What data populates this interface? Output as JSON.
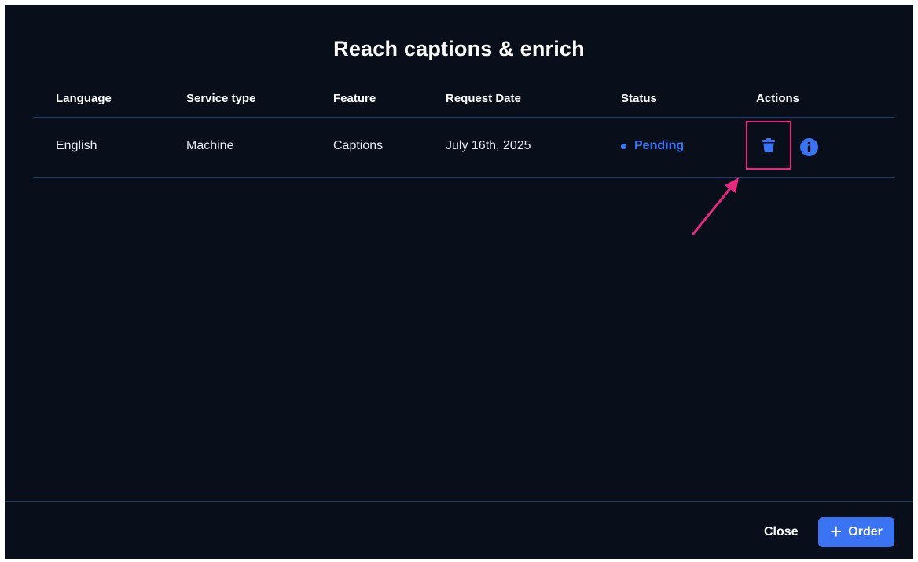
{
  "modal": {
    "title": "Reach captions & enrich"
  },
  "table": {
    "headers": [
      "Language",
      "Service type",
      "Feature",
      "Request Date",
      "Status",
      "Actions"
    ],
    "rows": [
      {
        "language": "English",
        "service_type": "Machine",
        "feature": "Captions",
        "request_date": "July 16th, 2025",
        "status": "Pending",
        "actions": [
          "trash-icon",
          "info-icon"
        ]
      }
    ]
  },
  "footer": {
    "close_label": "Close",
    "order_label": "Order",
    "order_icon": "plus-icon"
  },
  "colors": {
    "background": "#080e1a",
    "accent": "#3b74f2",
    "divider": "#1e3d73",
    "highlight": "#e8287f"
  }
}
